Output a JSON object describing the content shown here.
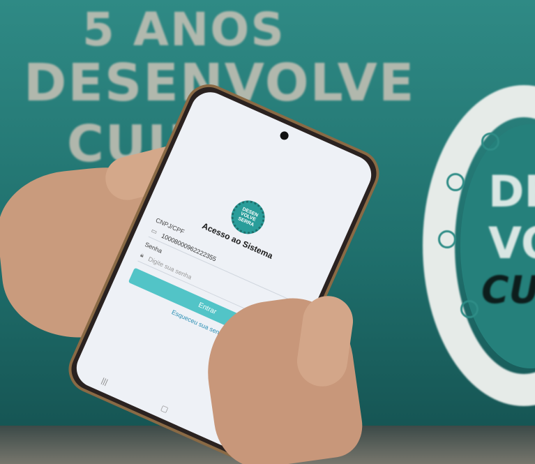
{
  "background": {
    "lines": [
      "5 ANOS",
      "DESENVOLVE",
      "CULTU"
    ],
    "ring_lines": [
      "DE",
      "VO",
      "CUL"
    ]
  },
  "phone": {
    "logo_text": "DESEN VOLVE SERRA",
    "title": "Acesso ao Sistema",
    "cpf_label": "CNPJ/CPF",
    "cpf_value": "10008000962222355",
    "password_label": "Senha",
    "password_placeholder": "Digite sua senha",
    "login_button": "Entrar",
    "forgot_link": "Esqueceu sua senha?"
  },
  "colors": {
    "teal_bg": "#2f8a85",
    "button": "#52c4c7",
    "link": "#2b8fb4"
  },
  "icons": {
    "cpf": "id-card-icon",
    "password": "lock-icon"
  }
}
